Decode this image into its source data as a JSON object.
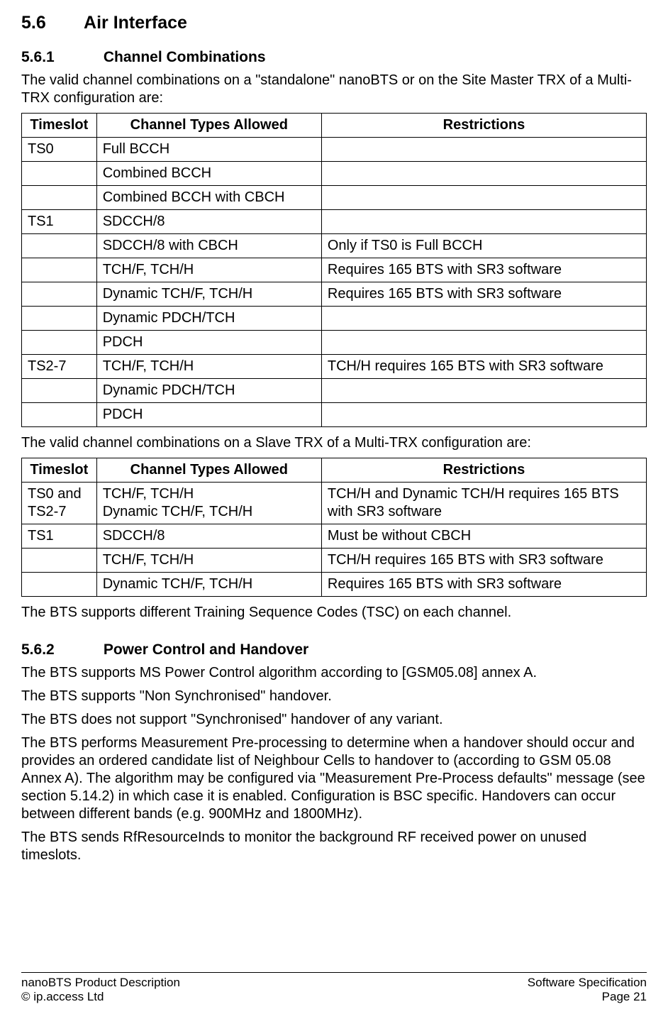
{
  "section": {
    "num": "5.6",
    "title": "Air Interface"
  },
  "sub1": {
    "num": "5.6.1",
    "title": "Channel Combinations",
    "intro": "The valid channel combinations on a \"standalone\" nanoBTS or on the Site Master TRX of a Multi-TRX configuration are:",
    "table1": {
      "headers": [
        "Timeslot",
        "Channel Types Allowed",
        "Restrictions"
      ],
      "rows": [
        [
          "TS0",
          "Full BCCH",
          ""
        ],
        [
          "",
          "Combined BCCH",
          ""
        ],
        [
          "",
          "Combined BCCH with CBCH",
          ""
        ],
        [
          "TS1",
          "SDCCH/8",
          ""
        ],
        [
          "",
          "SDCCH/8 with CBCH",
          "Only if TS0 is Full BCCH"
        ],
        [
          "",
          "TCH/F, TCH/H",
          "Requires 165 BTS with SR3 software"
        ],
        [
          "",
          "Dynamic TCH/F, TCH/H",
          "Requires 165 BTS with SR3 software"
        ],
        [
          "",
          "Dynamic PDCH/TCH",
          ""
        ],
        [
          "",
          "PDCH",
          ""
        ],
        [
          "TS2-7",
          "TCH/F, TCH/H",
          "TCH/H requires 165 BTS with SR3 software"
        ],
        [
          "",
          "Dynamic PDCH/TCH",
          ""
        ],
        [
          "",
          "PDCH",
          ""
        ]
      ]
    },
    "mid": "The valid channel combinations on a Slave TRX of a Multi-TRX configuration are:",
    "table2": {
      "headers": [
        "Timeslot",
        "Channel Types Allowed",
        "Restrictions"
      ],
      "rows": [
        [
          "TS0 and TS2-7",
          "TCH/F, TCH/H\nDynamic TCH/F, TCH/H",
          "TCH/H and Dynamic TCH/H requires 165 BTS with SR3 software"
        ],
        [
          "TS1",
          "SDCCH/8",
          "Must be without CBCH"
        ],
        [
          "",
          "TCH/F, TCH/H",
          "TCH/H requires 165 BTS with SR3 software"
        ],
        [
          "",
          "Dynamic TCH/F, TCH/H",
          "Requires 165 BTS with SR3 software"
        ]
      ]
    },
    "outro": "The BTS supports different Training Sequence Codes (TSC) on each channel."
  },
  "sub2": {
    "num": "5.6.2",
    "title": "Power Control and Handover",
    "paras": [
      "The BTS supports MS Power Control algorithm according to [GSM05.08] annex A.",
      "The BTS supports \"Non Synchronised\" handover.",
      "The BTS does not support \"Synchronised\" handover of any variant.",
      "The BTS performs Measurement Pre-processing to determine when a handover should occur and provides an ordered candidate list of Neighbour Cells to handover to (according to GSM 05.08 Annex A). The algorithm may be configured via \"Measurement Pre-Process defaults\" message (see section 5.14.2) in which case it is enabled. Configuration is BSC specific. Handovers can occur between different bands (e.g. 900MHz and 1800MHz).",
      "The BTS sends RfResourceInds to monitor the background RF received power on unused timeslots."
    ]
  },
  "footer": {
    "left1": "nanoBTS Product Description",
    "left2": "© ip.access Ltd",
    "right1": "Software Specification",
    "right2": "Page 21"
  }
}
